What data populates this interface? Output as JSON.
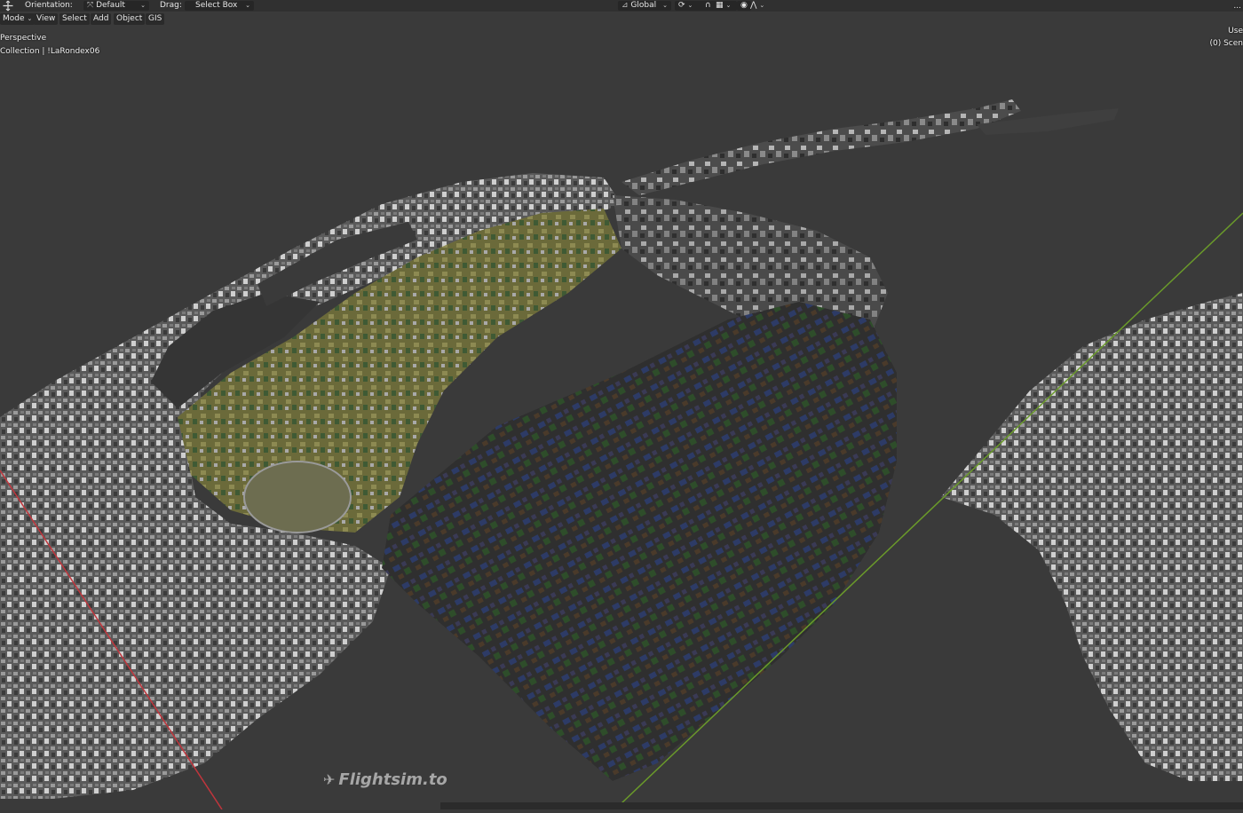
{
  "header": {
    "orientation_label": "Orientation:",
    "orientation_value": "Default",
    "drag_label": "Drag:",
    "drag_value": "Select Box",
    "transform_value": "Global"
  },
  "menu": {
    "mode": "Mode",
    "view": "View",
    "select": "Select",
    "add": "Add",
    "object": "Object",
    "gis": "GIS"
  },
  "viewport": {
    "projection": "Perspective",
    "collection_info": "Collection | !LaRondex06",
    "right_top": "Use",
    "right_scene": "(0) Scen",
    "right_corner": "..."
  },
  "watermark": {
    "text": "Flightsim.to"
  },
  "colors": {
    "background": "#3a3a3a",
    "header": "#303030",
    "axis_x": "#c0353c",
    "axis_y": "#6a9a2a"
  },
  "icons": {
    "tool": "move-cursor-icon",
    "orientation": "orientation-gizmo-icon",
    "transform": "global-transform-icon",
    "pivot": "pivot-icon",
    "snap": "snap-icon",
    "proportional": "proportional-edit-icon",
    "plane": "plane-icon"
  }
}
